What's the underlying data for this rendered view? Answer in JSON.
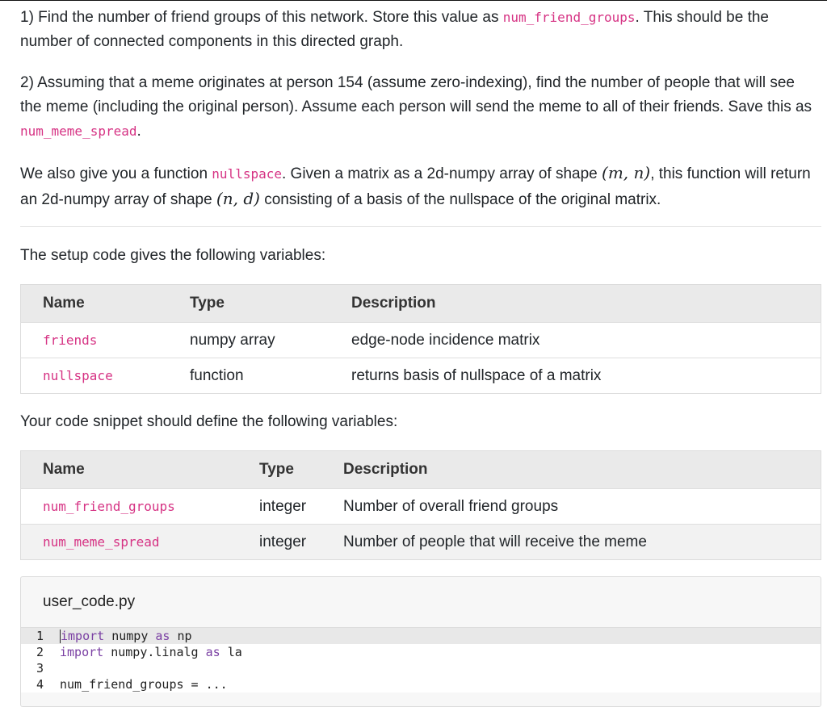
{
  "instructions": {
    "p1": {
      "text_a": "1) Find the number of friend groups of this network. Store this value as ",
      "code": "num_friend_groups",
      "text_b": ". This should be the number of connected components in this directed graph."
    },
    "p2": {
      "text_a": "2) Assuming that a meme originates at person 154 (assume zero-indexing), find the number of people that will see the meme (including the original person). Assume each person will send the meme to all of their friends. Save this as ",
      "code": "num_meme_spread",
      "text_b": "."
    },
    "p3": {
      "text_a": "We also give you a function ",
      "code": "nullspace",
      "text_b": ". Given a matrix as a 2d-numpy array of shape ",
      "math1": "(m, n)",
      "text_c": ", this function will return an 2d-numpy array of shape ",
      "math2": "(n, d)",
      "text_d": " consisting of a basis of the nullspace of the original matrix."
    }
  },
  "setup": {
    "intro": "The setup code gives the following variables:",
    "headers": [
      "Name",
      "Type",
      "Description"
    ],
    "rows": [
      {
        "name": "friends",
        "type": "numpy array",
        "description": "edge-node incidence matrix"
      },
      {
        "name": "nullspace",
        "type": "function",
        "description": "returns basis of nullspace of a matrix"
      }
    ]
  },
  "define": {
    "intro": "Your code snippet should define the following variables:",
    "headers": [
      "Name",
      "Type",
      "Description"
    ],
    "rows": [
      {
        "name": "num_friend_groups",
        "type": "integer",
        "description": "Number of overall friend groups"
      },
      {
        "name": "num_meme_spread",
        "type": "integer",
        "description": "Number of people that will receive the meme"
      }
    ]
  },
  "editor": {
    "filename": "user_code.py",
    "lines": [
      {
        "num": "1",
        "kw1": "import",
        "t1": " numpy ",
        "kw2": "as",
        "t2": " np"
      },
      {
        "num": "2",
        "kw1": "import",
        "t1": " numpy.linalg ",
        "kw2": "as",
        "t2": " la"
      },
      {
        "num": "3",
        "text": ""
      },
      {
        "num": "4",
        "text": "num_friend_groups = ..."
      }
    ]
  }
}
